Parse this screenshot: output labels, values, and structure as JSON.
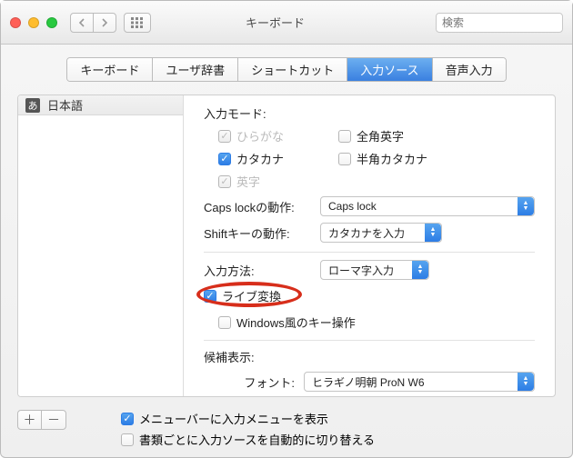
{
  "window": {
    "title": "キーボード"
  },
  "search": {
    "placeholder": "検索"
  },
  "tabs": [
    {
      "label": "キーボード",
      "active": false
    },
    {
      "label": "ユーザ辞書",
      "active": false
    },
    {
      "label": "ショートカット",
      "active": false
    },
    {
      "label": "入力ソース",
      "active": true
    },
    {
      "label": "音声入力",
      "active": false
    }
  ],
  "sidebar": {
    "items": [
      {
        "icon_text": "あ",
        "label": "日本語"
      }
    ]
  },
  "right": {
    "input_mode_label": "入力モード:",
    "modes": {
      "hiragana": {
        "label": "ひらがな",
        "state": "mixed"
      },
      "katakana": {
        "label": "カタカナ",
        "state": "checked"
      },
      "eisu": {
        "label": "英字",
        "state": "mixed"
      },
      "zenkaku": {
        "label": "全角英字",
        "state": "unchecked"
      },
      "hankaku_kata": {
        "label": "半角カタカナ",
        "state": "unchecked"
      }
    },
    "capslock_label": "Caps lockの動作:",
    "capslock_value": "Caps lock",
    "shift_label": "Shiftキーの動作:",
    "shift_value": "カタカナを入力",
    "input_method_label": "入力方法:",
    "input_method_value": "ローマ字入力",
    "live_conversion": {
      "label": "ライブ変換",
      "state": "checked"
    },
    "windows_key": {
      "label": "Windows風のキー操作",
      "state": "unchecked"
    },
    "candidate_label": "候補表示:",
    "font_label": "フォント:",
    "font_value": "ヒラギノ明朝 ProN W6"
  },
  "bottom": {
    "menu_show": {
      "label": "メニューバーに入力メニューを表示",
      "state": "checked"
    },
    "auto_switch": {
      "label": "書類ごとに入力ソースを自動的に切り替える",
      "state": "unchecked"
    }
  }
}
